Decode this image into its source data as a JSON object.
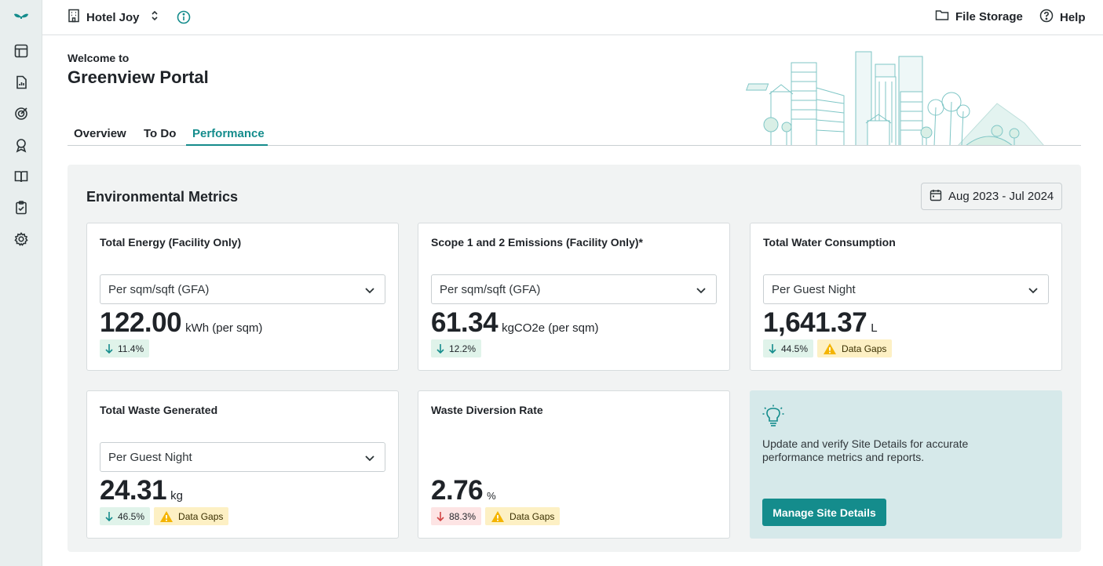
{
  "app": {
    "site_name": "Hotel Joy"
  },
  "sidebar": {
    "items": [
      {
        "icon": "logo-icon"
      },
      {
        "icon": "table-icon"
      },
      {
        "icon": "report-icon"
      },
      {
        "icon": "target-icon"
      },
      {
        "icon": "award-icon"
      },
      {
        "icon": "book-icon"
      },
      {
        "icon": "clipboard-check-icon"
      },
      {
        "icon": "gear-icon"
      }
    ]
  },
  "topbar": {
    "file_storage": "File Storage",
    "help": "Help"
  },
  "welcome": {
    "small": "Welcome to",
    "title": "Greenview Portal"
  },
  "tabs": [
    {
      "label": "Overview",
      "active": false
    },
    {
      "label": "To Do",
      "active": false
    },
    {
      "label": "Performance",
      "active": true
    }
  ],
  "metrics": {
    "title": "Environmental Metrics",
    "date_range": "Aug 2023 - Jul 2024",
    "cards": [
      {
        "title": "Total Energy (Facility Only)",
        "select": "Per sqm/sqft (GFA)",
        "value": "122.00",
        "unit": "kWh (per sqm)",
        "change": "11.4%",
        "direction": "down",
        "data_gaps": null
      },
      {
        "title": "Scope 1 and 2 Emissions (Facility Only)*",
        "select": "Per sqm/sqft (GFA)",
        "value": "61.34",
        "unit": "kgCO2e (per sqm)",
        "change": "12.2%",
        "direction": "down",
        "data_gaps": null
      },
      {
        "title": "Total Water Consumption",
        "select": "Per Guest Night",
        "value": "1,641.37",
        "unit": "L",
        "change": "44.5%",
        "direction": "down",
        "data_gaps": "Data Gaps"
      },
      {
        "title": "Total Waste Generated",
        "select": "Per Guest Night",
        "value": "24.31",
        "unit": "kg",
        "change": "46.5%",
        "direction": "down",
        "data_gaps": "Data Gaps"
      },
      {
        "title": "Waste Diversion Rate",
        "select": null,
        "value": "2.76",
        "unit": "%",
        "change": "88.3%",
        "direction": "down-negative",
        "data_gaps": "Data Gaps"
      }
    ],
    "tip": {
      "text": "Update and verify Site Details for accurate performance metrics and reports.",
      "button": "Manage Site Details"
    }
  },
  "colors": {
    "accent": "#148c8c",
    "sidebar_bg": "#e8eeee",
    "panel_bg": "#f1f3f3",
    "positive_bg": "#e0f3ea",
    "negative_bg": "#fde4e4",
    "warning_bg": "#fdf0c4",
    "warning_icon": "#f4b400"
  }
}
